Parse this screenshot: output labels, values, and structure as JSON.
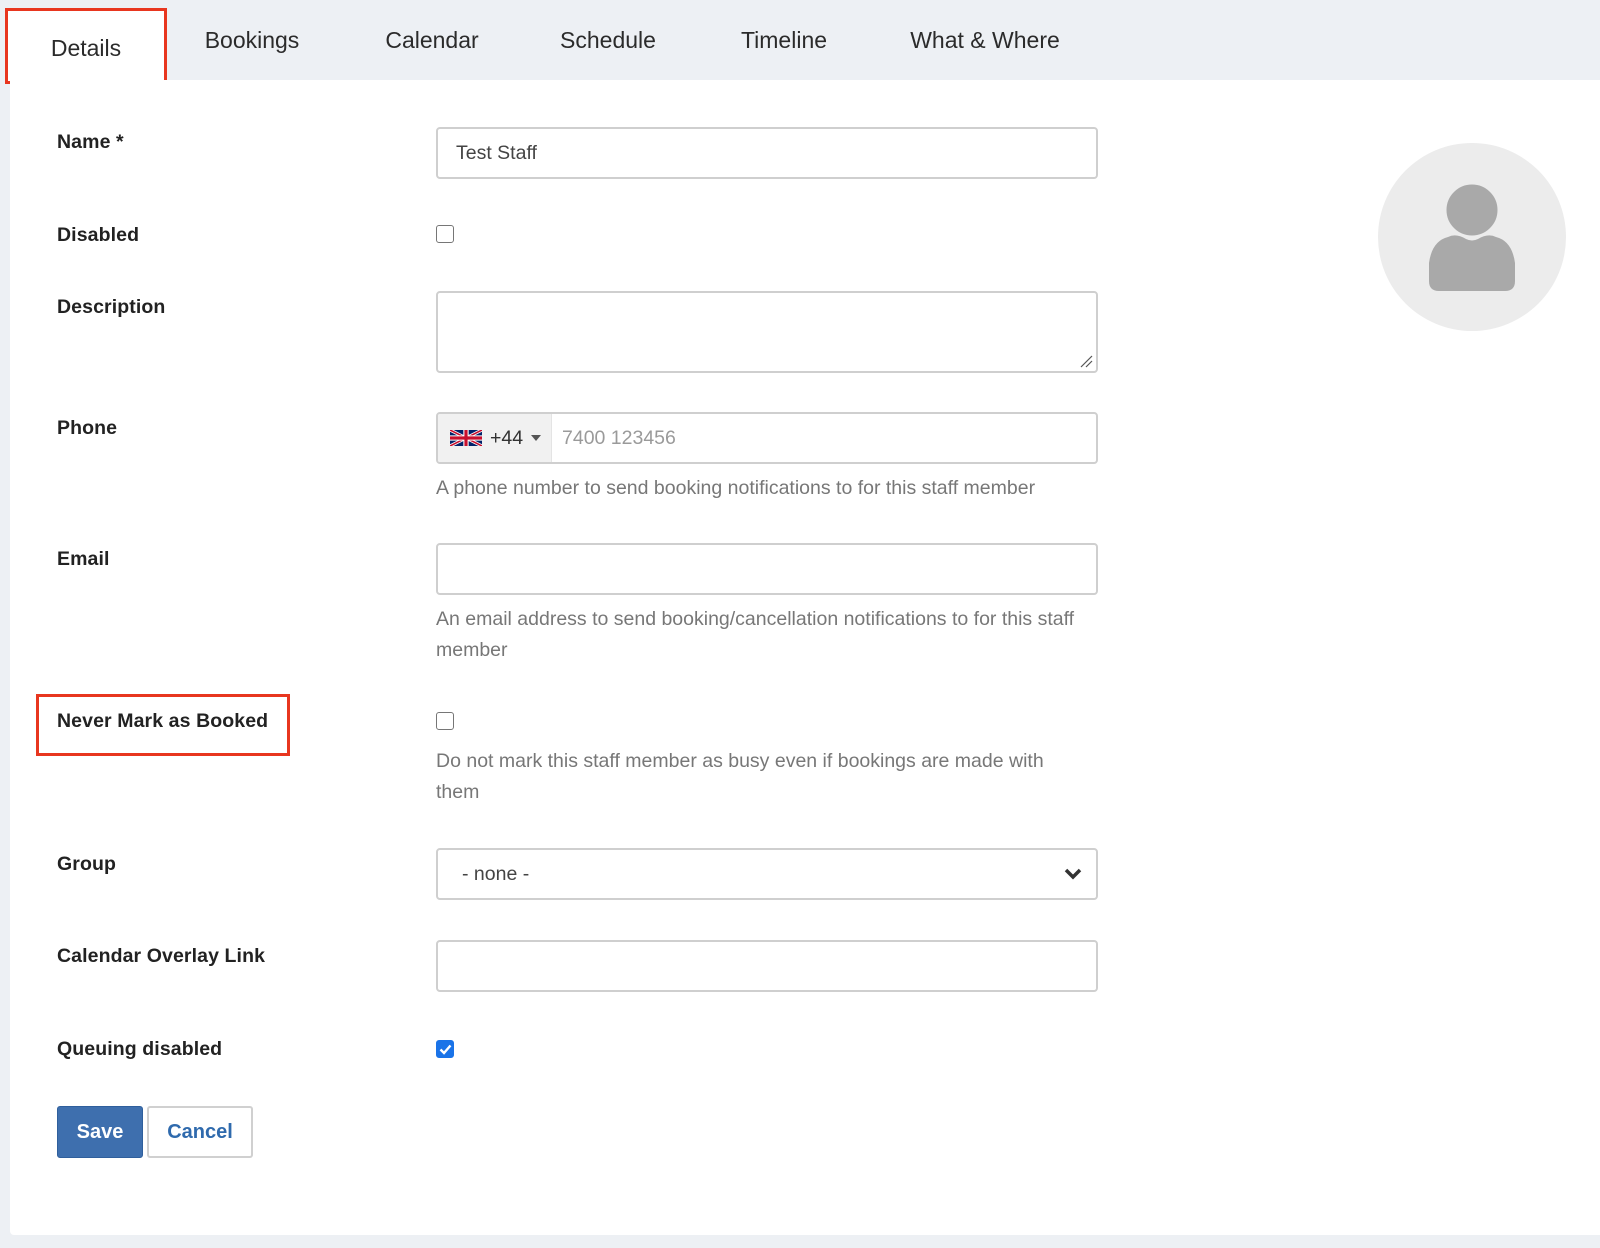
{
  "tabs": [
    {
      "label": "Details",
      "active": true
    },
    {
      "label": "Bookings",
      "active": false
    },
    {
      "label": "Calendar",
      "active": false
    },
    {
      "label": "Schedule",
      "active": false
    },
    {
      "label": "Timeline",
      "active": false
    },
    {
      "label": "What & Where",
      "active": false
    }
  ],
  "form": {
    "name": {
      "label": "Name *",
      "value": "Test Staff"
    },
    "disabled": {
      "label": "Disabled",
      "checked": false
    },
    "description": {
      "label": "Description",
      "value": ""
    },
    "phone": {
      "label": "Phone",
      "country_flag": "uk-flag-icon",
      "country_code": "+44",
      "placeholder": "7400 123456",
      "value": "",
      "help": "A phone number to send booking notifications to for this staff member"
    },
    "email": {
      "label": "Email",
      "value": "",
      "help": "An email address to send booking/cancellation notifications to for this staff member"
    },
    "never_mark_booked": {
      "label": "Never Mark as Booked",
      "checked": false,
      "help": "Do not mark this staff member as busy even if bookings are made with them"
    },
    "group": {
      "label": "Group",
      "selected": "- none -"
    },
    "calendar_overlay": {
      "label": "Calendar Overlay Link",
      "value": ""
    },
    "queuing_disabled": {
      "label": "Queuing disabled",
      "checked": true
    }
  },
  "buttons": {
    "save": "Save",
    "cancel": "Cancel"
  },
  "avatar": {
    "icon": "user-placeholder-icon"
  },
  "colors": {
    "highlight": "#e8361f",
    "primary": "#3e6fae",
    "link": "#2f6aad",
    "checkbox_checked": "#1a73e8",
    "background": "#edf0f4"
  }
}
